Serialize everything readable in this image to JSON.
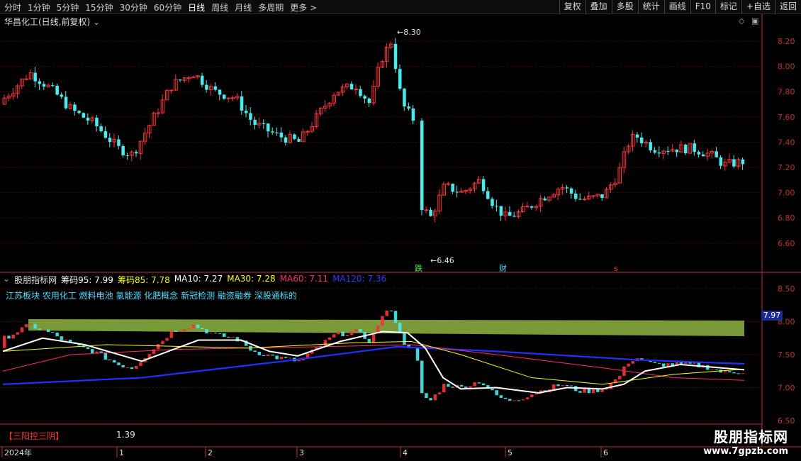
{
  "toolbar": {
    "periods": [
      "分时",
      "1分钟",
      "5分钟",
      "15分钟",
      "30分钟",
      "60分钟",
      "日线",
      "周线",
      "月线",
      "多周期",
      "更多 >"
    ],
    "active_period": "日线",
    "tools": [
      "复权",
      "叠加",
      "多股",
      "统计",
      "画线",
      "F10",
      "标记",
      "+自选",
      "返回"
    ]
  },
  "main": {
    "title": "华昌化工(日线,前复权)",
    "price_ticks": [
      "8.20",
      "8.00",
      "7.80",
      "7.60",
      "7.40",
      "7.20",
      "7.00",
      "6.80",
      "6.60"
    ],
    "high_label": "8.30",
    "low_label": "6.46",
    "markers": [
      "跌",
      "财",
      "s"
    ]
  },
  "indicator": {
    "name": "股朋指标网",
    "items": [
      {
        "label": "筹码95:",
        "value": "7.99",
        "color": "#ffffff"
      },
      {
        "label": "筹码85:",
        "value": "7.78",
        "color": "#ffff00"
      },
      {
        "label": "MA10:",
        "value": "7.27",
        "color": "#ffffff"
      },
      {
        "label": "MA30:",
        "value": "7.28",
        "color": "#ffff00"
      },
      {
        "label": "MA60:",
        "value": "7.11",
        "color": "#ff2a6a"
      },
      {
        "label": "MA120:",
        "value": "7.36",
        "color": "#2a3cff"
      }
    ],
    "concepts": "江苏板块 农用化工 燃料电池 氢能源 化肥概念 新冠检测 融资融券 深股通标的",
    "ticks": [
      "8.50",
      "8.00",
      "7.50",
      "7.00",
      "6.50"
    ],
    "price_box": "7.97",
    "bottom_label": "【三阳控三阴】",
    "bottom_value": "1.39"
  },
  "timeline": {
    "labels": [
      "2024年",
      "1",
      "2",
      "3",
      "4",
      "5",
      "6"
    ]
  },
  "watermark": {
    "name": "股朋指标网",
    "url": "www.7gpzb.com"
  },
  "colors": {
    "up": "#ff3030",
    "down": "#40f0f0",
    "grid": "#5a0000",
    "axis": "#c03030",
    "band": "#7a9a3a"
  }
}
